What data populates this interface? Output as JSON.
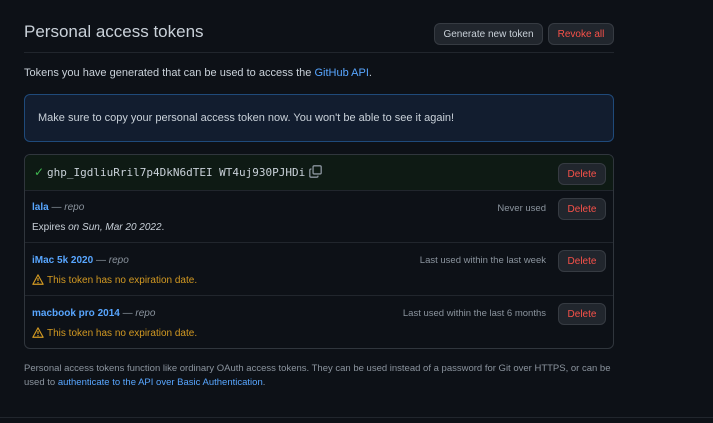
{
  "header": {
    "title": "Personal access tokens",
    "generate_label": "Generate new token",
    "revoke_label": "Revoke all"
  },
  "intro": {
    "text": "Tokens you have generated that can be used to access the ",
    "link": "GitHub API",
    "suffix": "."
  },
  "flash": {
    "message": "Make sure to copy your personal access token now. You won't be able to see it again!"
  },
  "new_token": {
    "value": "ghp_IgdliuRril7p4DkN6dTEI WT4uj930PJHDi",
    "delete_label": "Delete"
  },
  "tokens": [
    {
      "name": "lala",
      "separator": "—",
      "scope": "repo",
      "last_used": "Never used",
      "delete_label": "Delete",
      "expiry_prefix": "Expires ",
      "expiry_date": "on Sun, Mar 20 2022",
      "expiry_suffix": "."
    },
    {
      "name": "iMac 5k 2020",
      "separator": "—",
      "scope": "repo",
      "last_used": "Last used within the last week",
      "delete_label": "Delete",
      "warning": "This token has no expiration date."
    },
    {
      "name": "macbook pro 2014",
      "separator": "—",
      "scope": "repo",
      "last_used": "Last used within the last 6 months",
      "delete_label": "Delete",
      "warning": "This token has no expiration date."
    }
  ],
  "footer": {
    "text": "Personal access tokens function like ordinary OAuth access tokens. They can be used instead of a password for Git over HTTPS, or can be used to ",
    "link": "authenticate to the API over Basic Authentication",
    "suffix": "."
  },
  "icons": {
    "check": "check-icon",
    "copy": "copy-icon",
    "warning": "alert-icon"
  },
  "colors": {
    "background": "#0d1117",
    "link": "#58a6ff",
    "danger": "#f85149",
    "success": "#3fb950",
    "warning": "#d29922",
    "flash_bg": "#121d2f"
  }
}
